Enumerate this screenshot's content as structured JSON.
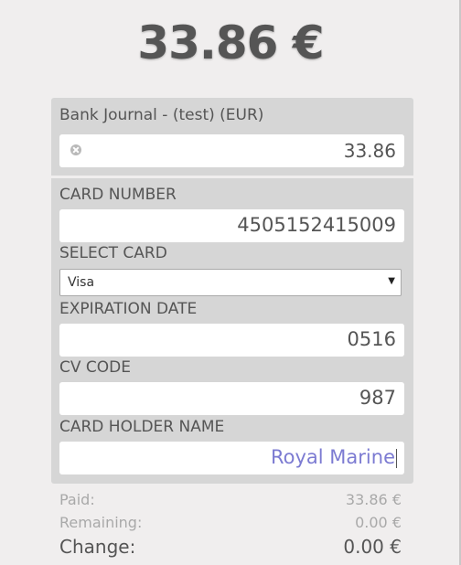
{
  "header": {
    "total_due": "33.86 €"
  },
  "payment_line": {
    "journal_label": "Bank Journal - (test) (EUR)",
    "amount": "33.86"
  },
  "card_form": {
    "card_number_label": "CARD NUMBER",
    "card_number_value": "4505152415009",
    "select_card_label": "SELECT CARD",
    "select_card_value": "Visa",
    "expiration_label": "EXPIRATION DATE",
    "expiration_value": "0516",
    "cv_code_label": "CV CODE",
    "cv_code_value": "987",
    "holder_label": "CARD HOLDER NAME",
    "holder_value": "Royal Marine"
  },
  "summary": {
    "paid_label": "Paid:",
    "paid_value": "33.86 €",
    "remaining_label": "Remaining:",
    "remaining_value": "0.00 €",
    "change_label": "Change:",
    "change_value": "0.00 €"
  },
  "colors": {
    "background": "#f0eeee",
    "panel": "#d6d6d6",
    "text": "#555555",
    "muted": "#a9a9a9",
    "active_input_text": "#7c7bd2"
  },
  "icons": {
    "clear": "clear-circle-icon",
    "select_arrow": "triangle-down-icon"
  }
}
